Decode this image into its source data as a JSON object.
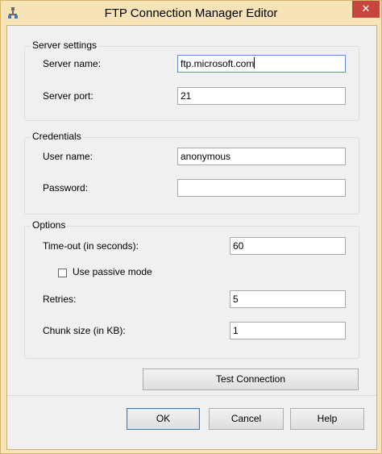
{
  "window": {
    "title": "FTP Connection Manager Editor",
    "close_glyph": "✕"
  },
  "server_settings": {
    "title": "Server settings",
    "server_name_label": "Server name:",
    "server_name_value": "ftp.microsoft.com",
    "server_port_label": "Server port:",
    "server_port_value": "21"
  },
  "credentials": {
    "title": "Credentials",
    "user_name_label": "User name:",
    "user_name_value": "anonymous",
    "password_label": "Password:",
    "password_value": ""
  },
  "options": {
    "title": "Options",
    "timeout_label": "Time-out (in seconds):",
    "timeout_value": "60",
    "passive_mode_label": "Use passive mode",
    "passive_mode_checked": false,
    "retries_label": "Retries:",
    "retries_value": "5",
    "chunk_size_label": "Chunk size (in KB):",
    "chunk_size_value": "1"
  },
  "buttons": {
    "test_connection": "Test Connection",
    "ok": "OK",
    "cancel": "Cancel",
    "help": "Help"
  },
  "colors": {
    "title_bar": "#f6e3b7",
    "close_button": "#c7463b",
    "dialog_bg": "#f0f0f0",
    "focus_border": "#5b8ed6"
  }
}
